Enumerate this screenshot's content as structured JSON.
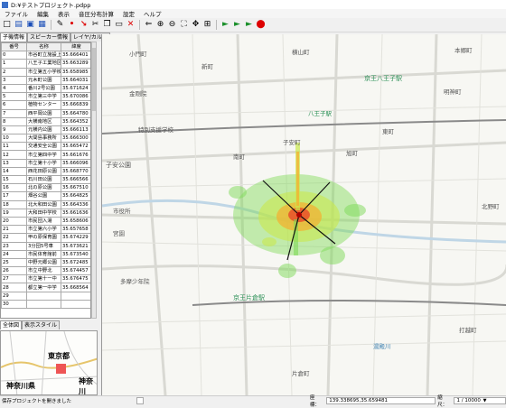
{
  "window": {
    "title": "D:¥テストプロジェクト.pdpp"
  },
  "menu": [
    "ファイル",
    "編集",
    "表示",
    "音圧分布計算",
    "設定",
    "ヘルプ"
  ],
  "tabs_top": [
    "子機情報",
    "スピーカー情報",
    "レイヤ/カルム"
  ],
  "table": {
    "headers": [
      "番号",
      "名称",
      "緯度"
    ],
    "rows": [
      [
        "0",
        "市谷町立施設上",
        "35.666401"
      ],
      [
        "1",
        "八王子工業地区",
        "35.663289"
      ],
      [
        "2",
        "市立第五小学校",
        "35.658985"
      ],
      [
        "3",
        "元木町公園",
        "35.664031"
      ],
      [
        "4",
        "番川2号公園",
        "35.671624"
      ],
      [
        "5",
        "市立第三中学",
        "35.670086"
      ],
      [
        "6",
        "植物センター",
        "35.666839"
      ],
      [
        "7",
        "西平岡公園",
        "35.664780"
      ],
      [
        "8",
        "大横南地区",
        "35.664352"
      ],
      [
        "9",
        "元横内公園",
        "35.666113"
      ],
      [
        "10",
        "大間島事務所",
        "35.666300"
      ],
      [
        "11",
        "交通安全公園",
        "35.665472"
      ],
      [
        "12",
        "市立第四中学",
        "35.661676"
      ],
      [
        "13",
        "市立第十小学",
        "35.666096"
      ],
      [
        "14",
        "西花田原公園",
        "35.668770"
      ],
      [
        "15",
        "石川田公園",
        "35.666566"
      ],
      [
        "16",
        "北の原公園",
        "35.667510"
      ],
      [
        "17",
        "畑谷公園",
        "35.664825"
      ],
      [
        "18",
        "北大和田公園",
        "35.664336"
      ],
      [
        "19",
        "大和田中学校",
        "35.661636"
      ],
      [
        "20",
        "市民団入湯",
        "35.658606"
      ],
      [
        "21",
        "市立第六小学",
        "35.657658"
      ],
      [
        "22",
        "甲の原保育園",
        "35.674229"
      ],
      [
        "23",
        "3分団5号車",
        "35.673621"
      ],
      [
        "24",
        "市民体育館前",
        "35.673540"
      ],
      [
        "25",
        "中野元郷公園",
        "35.672485"
      ],
      [
        "26",
        "市立中野北",
        "35.674457"
      ],
      [
        "27",
        "市立第十一中",
        "35.676475"
      ],
      [
        "28",
        "都立第一中学",
        "35.668564"
      ],
      [
        "29",
        "",
        ""
      ],
      [
        "30",
        "",
        ""
      ]
    ]
  },
  "tabs_bottom": [
    "全体図",
    "表示スタイル"
  ],
  "overview": {
    "label1": "東京都",
    "label2": "神奈川県",
    "label3": "神奈川"
  },
  "map_labels": [
    "横山町",
    "小門町",
    "新町",
    "八王子駅",
    "京王八王子駅",
    "金剛院",
    "本郷町",
    "子安町",
    "南町",
    "特別支援学校",
    "東町",
    "片倉町",
    "市役所",
    "宮園",
    "多摩少年院",
    "京王片倉駅",
    "打越町",
    "湯殿川",
    "子安公園",
    "明神町",
    "北野町",
    "旭町"
  ],
  "status": {
    "message": "保存プロジェクトを開きました",
    "coord_label": "座標：",
    "coord_value": "139.338695,35.659481",
    "scale_label": "縮尺：",
    "scale_value": "1 / 10000"
  },
  "colors": {
    "accent_red": "#d00000",
    "map_bg": "#f7f7f3",
    "station_green": "#2a8f55"
  }
}
